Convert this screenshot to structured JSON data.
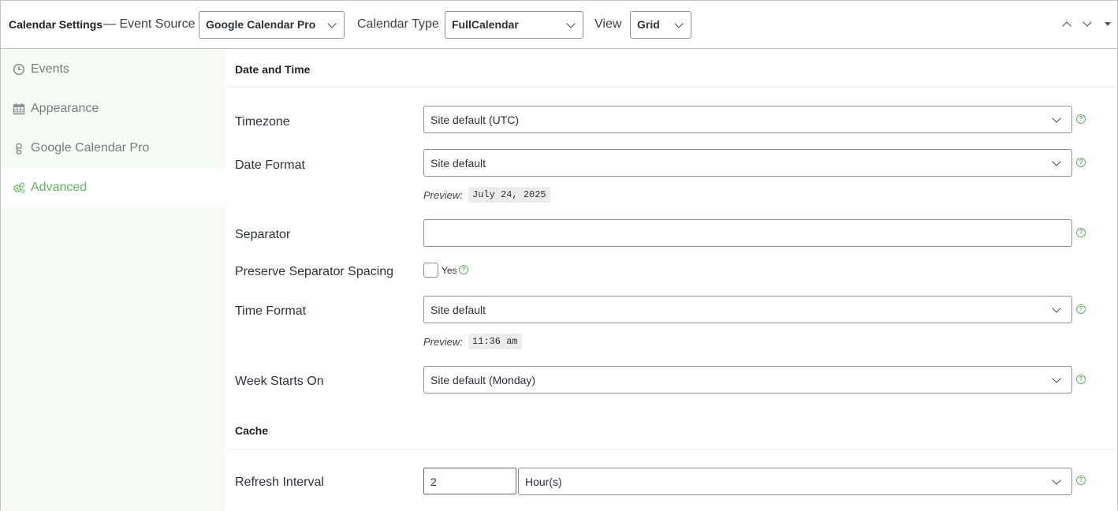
{
  "header": {
    "title": "Calendar Settings",
    "event_source_label": "— Event Source",
    "event_source_value": "Google Calendar Pro",
    "calendar_type_label": "Calendar Type",
    "calendar_type_value": "FullCalendar",
    "view_label": "View",
    "view_value": "Grid"
  },
  "sidebar": {
    "items": [
      {
        "label": "Events",
        "icon": "clock-icon",
        "active": false
      },
      {
        "label": "Appearance",
        "icon": "calendar-icon",
        "active": false
      },
      {
        "label": "Google Calendar Pro",
        "icon": "google-icon",
        "active": false
      },
      {
        "label": "Advanced",
        "icon": "gears-icon",
        "active": true
      }
    ]
  },
  "main": {
    "section_datetime": "Date and Time",
    "timezone": {
      "label": "Timezone",
      "value": "Site default (UTC)"
    },
    "date_format": {
      "label": "Date Format",
      "value": "Site default",
      "preview_label": "Preview:",
      "preview_value": "July 24, 2025"
    },
    "separator": {
      "label": "Separator",
      "value": ""
    },
    "preserve_spacing": {
      "label": "Preserve Separator Spacing",
      "checkbox_label": "Yes",
      "checked": false
    },
    "time_format": {
      "label": "Time Format",
      "value": "Site default",
      "preview_label": "Preview:",
      "preview_value": "11:36 am"
    },
    "week_start": {
      "label": "Week Starts On",
      "value": "Site default (Monday)"
    },
    "section_cache": "Cache",
    "refresh": {
      "label": "Refresh Interval",
      "number": "2",
      "unit": "Hour(s)"
    },
    "help_glyph": "?"
  },
  "colors": {
    "accent": "#5cb85c",
    "sidebar_bg": "#f6fbf4",
    "border": "#8c8f94"
  }
}
